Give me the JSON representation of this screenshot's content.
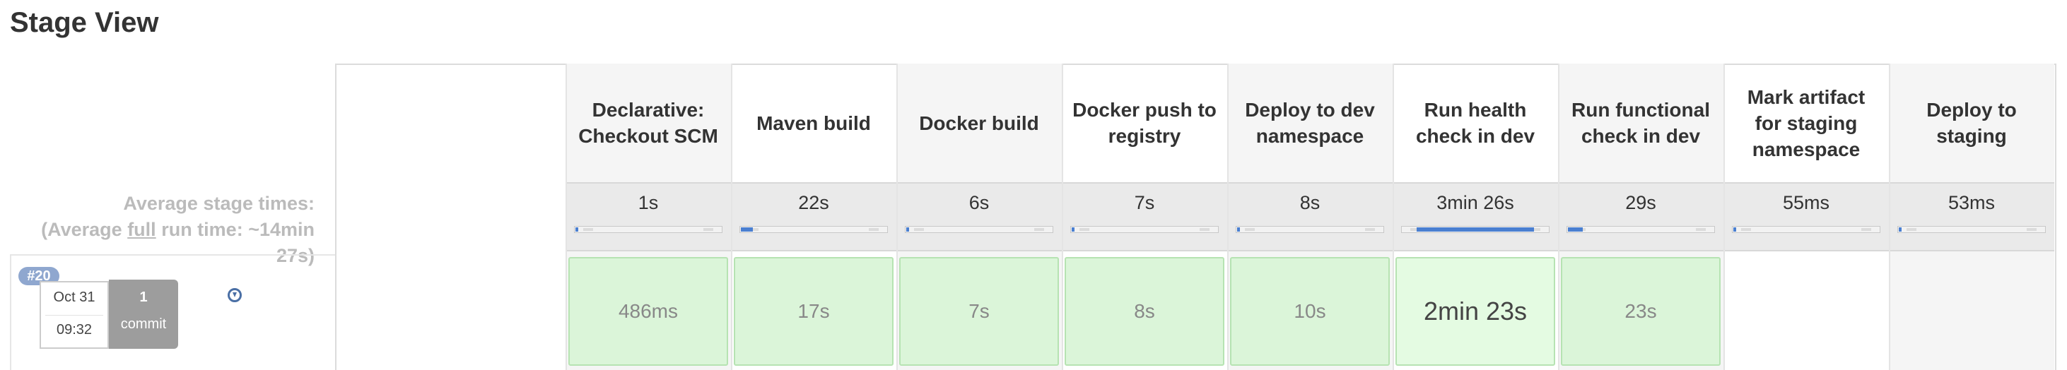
{
  "title": "Stage View",
  "average": {
    "line1": "Average stage times:",
    "line2_prefix": "(Average ",
    "line2_full": "full",
    "line2_suffix": " run time: ~14min",
    "line3": "27s)"
  },
  "run": {
    "badge": "#20",
    "date": "Oct 31",
    "time": "09:32",
    "commit_count": "1",
    "commit_label": "commit"
  },
  "stages": [
    {
      "name": "Declarative: Checkout SCM",
      "avg": "1s",
      "cell": "486ms",
      "progress": 0.02,
      "big": false,
      "empty": false
    },
    {
      "name": "Maven build",
      "avg": "22s",
      "cell": "17s",
      "progress": 0.08,
      "big": false,
      "empty": false
    },
    {
      "name": "Docker build",
      "avg": "6s",
      "cell": "7s",
      "progress": 0.02,
      "big": false,
      "empty": false
    },
    {
      "name": "Docker push to registry",
      "avg": "7s",
      "cell": "8s",
      "progress": 0.02,
      "big": false,
      "empty": false
    },
    {
      "name": "Deploy to dev namespace",
      "avg": "8s",
      "cell": "10s",
      "progress": 0.02,
      "big": false,
      "empty": false
    },
    {
      "name": "Run health check in dev",
      "avg": "3min 26s",
      "cell": "2min 23s",
      "progress": 0.8,
      "big": true,
      "empty": false
    },
    {
      "name": "Run functional check in dev",
      "avg": "29s",
      "cell": "23s",
      "progress": 0.1,
      "big": false,
      "empty": false
    },
    {
      "name": "Mark artifact for staging namespace",
      "avg": "55ms",
      "cell": "",
      "progress": 0.01,
      "big": false,
      "empty": true
    },
    {
      "name": "Deploy to staging",
      "avg": "53ms",
      "cell": "",
      "progress": 0.01,
      "big": false,
      "empty": true
    }
  ]
}
